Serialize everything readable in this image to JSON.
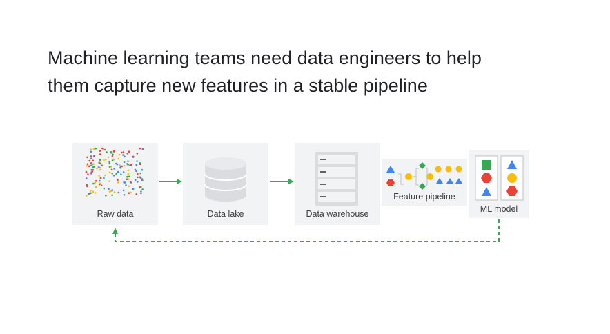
{
  "title": {
    "line1": "Machine learning teams need data engineers to help",
    "line2": "them capture new features in a stable pipeline"
  },
  "stages": {
    "raw_data": "Raw data",
    "data_lake": "Data lake",
    "data_warehouse": "Data warehouse",
    "feature_pipeline": "Feature pipeline",
    "ml_model": "ML model"
  },
  "colors": {
    "box_bg": "#f1f3f4",
    "arrow_green": "#34a853",
    "blue": "#4285f4",
    "red": "#ea4335",
    "yellow": "#fbbc04",
    "green": "#34a853"
  }
}
